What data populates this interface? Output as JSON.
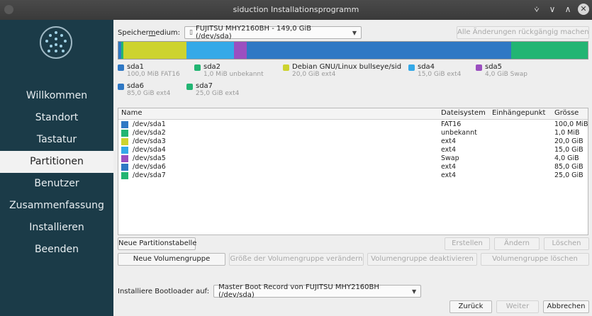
{
  "window": {
    "title": "siduction Installationsprogramm"
  },
  "sidebar": {
    "items": [
      {
        "label": "Willkommen",
        "active": false
      },
      {
        "label": "Standort",
        "active": false
      },
      {
        "label": "Tastatur",
        "active": false
      },
      {
        "label": "Partitionen",
        "active": true
      },
      {
        "label": "Benutzer",
        "active": false
      },
      {
        "label": "Zusammenfassung",
        "active": false
      },
      {
        "label": "Installieren",
        "active": false
      },
      {
        "label": "Beenden",
        "active": false
      }
    ]
  },
  "storage": {
    "label_pre": "Speicher",
    "label_ul": "m",
    "label_post": "edium:",
    "selected": "FUJITSU MHY2160BH - 149,0 GiB (/dev/sda)",
    "revert_button": "Alle Änderungen rückgängig machen"
  },
  "disk_colors": {
    "sda1": "#2f78c4",
    "sda2": "#22b573",
    "sda3": "#cdd32f",
    "sda4": "#34a9e8",
    "sda5": "#9b4fc0",
    "sda6": "#2f78c4",
    "sda7": "#22b573"
  },
  "legend": [
    {
      "name": "sda1",
      "detail": "100,0 MiB FAT16",
      "color": "#2f78c4"
    },
    {
      "name": "sda2",
      "detail": "1,0 MiB unbekannt",
      "color": "#22b573"
    },
    {
      "name": "Debian GNU/Linux bullseye/sid",
      "detail": "20,0 GiB ext4",
      "color": "#cdd32f"
    },
    {
      "name": "sda4",
      "detail": "15,0 GiB ext4",
      "color": "#34a9e8"
    },
    {
      "name": "sda5",
      "detail": "4,0 GiB Swap",
      "color": "#9b4fc0"
    },
    {
      "name": "sda6",
      "detail": "85,0 GiB ext4",
      "color": "#2f78c4"
    },
    {
      "name": "sda7",
      "detail": "25,0 GiB ext4",
      "color": "#22b573"
    }
  ],
  "table": {
    "headers": {
      "name": "Name",
      "fs": "Dateisystem",
      "mount": "Einhängepunkt",
      "size": "Grösse"
    },
    "rows": [
      {
        "name": "/dev/sda1",
        "fs": "FAT16",
        "mount": "",
        "size": "100,0 MiB",
        "color": "#2f78c4"
      },
      {
        "name": "/dev/sda2",
        "fs": "unbekannt",
        "mount": "",
        "size": "1,0 MiB",
        "color": "#22b573"
      },
      {
        "name": "/dev/sda3",
        "fs": "ext4",
        "mount": "",
        "size": "20,0 GiB",
        "color": "#cdd32f"
      },
      {
        "name": "/dev/sda4",
        "fs": "ext4",
        "mount": "",
        "size": "15,0 GiB",
        "color": "#34a9e8"
      },
      {
        "name": "/dev/sda5",
        "fs": "Swap",
        "mount": "",
        "size": "4,0 GiB",
        "color": "#9b4fc0"
      },
      {
        "name": "/dev/sda6",
        "fs": "ext4",
        "mount": "",
        "size": "85,0 GiB",
        "color": "#2f78c4"
      },
      {
        "name": "/dev/sda7",
        "fs": "ext4",
        "mount": "",
        "size": "25,0 GiB",
        "color": "#22b573"
      }
    ]
  },
  "buttons": {
    "new_partition_table": "Neue Partitionstabelle",
    "create": "Erstellen",
    "change": "Ändern",
    "delete": "Löschen",
    "new_volume_group": "Neue Volumengruppe",
    "resize_volume_group": "Größe der Volumengruppe verändern",
    "deactivate_volume_group": "Volumengruppe deaktivieren",
    "delete_volume_group": "Volumengruppe löschen"
  },
  "bootloader": {
    "label": "Installiere Bootloader auf:",
    "selected": "Master Boot Record von FUJITSU MHY2160BH (/dev/sda)"
  },
  "footer": {
    "back": "Zurück",
    "next": "Weiter",
    "cancel": "Abbrechen"
  }
}
